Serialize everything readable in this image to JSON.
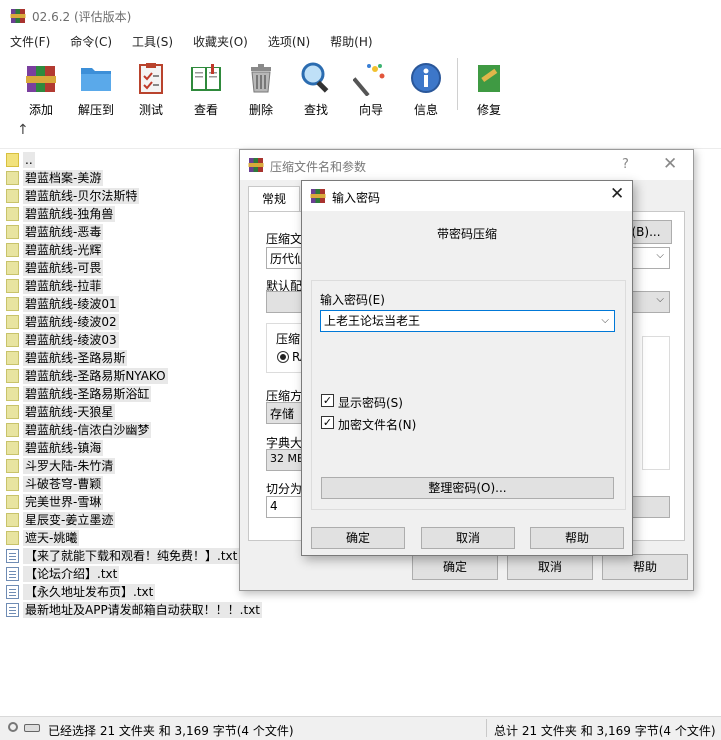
{
  "window": {
    "title": "02.6.2 (评估版本)",
    "menu": [
      "文件(F)",
      "命令(C)",
      "工具(S)",
      "收藏夹(O)",
      "选项(N)",
      "帮助(H)"
    ],
    "toolbar": [
      {
        "label": "添加",
        "icon": "add-archive-icon"
      },
      {
        "label": "解压到",
        "icon": "extract-folder-icon"
      },
      {
        "label": "测试",
        "icon": "test-clipboard-icon"
      },
      {
        "label": "查看",
        "icon": "view-book-icon"
      },
      {
        "label": "删除",
        "icon": "delete-trash-icon"
      },
      {
        "label": "查找",
        "icon": "find-magnifier-icon"
      },
      {
        "label": "向导",
        "icon": "wizard-wand-icon"
      },
      {
        "label": "信息",
        "icon": "info-icon"
      },
      {
        "label": "修复",
        "icon": "repair-icon"
      }
    ]
  },
  "files": [
    {
      "name": "..",
      "type": "parent"
    },
    {
      "name": "碧蓝档案-美游",
      "type": "folder"
    },
    {
      "name": "碧蓝航线-贝尔法斯特",
      "type": "folder"
    },
    {
      "name": "碧蓝航线-独角兽",
      "type": "folder"
    },
    {
      "name": "碧蓝航线-恶毒",
      "type": "folder"
    },
    {
      "name": "碧蓝航线-光辉",
      "type": "folder"
    },
    {
      "name": "碧蓝航线-可畏",
      "type": "folder"
    },
    {
      "name": "碧蓝航线-拉菲",
      "type": "folder"
    },
    {
      "name": "碧蓝航线-绫波01",
      "type": "folder"
    },
    {
      "name": "碧蓝航线-绫波02",
      "type": "folder"
    },
    {
      "name": "碧蓝航线-绫波03",
      "type": "folder"
    },
    {
      "name": "碧蓝航线-圣路易斯",
      "type": "folder"
    },
    {
      "name": "碧蓝航线-圣路易斯NYAKO",
      "type": "folder"
    },
    {
      "name": "碧蓝航线-圣路易斯浴缸",
      "type": "folder"
    },
    {
      "name": "碧蓝航线-天狼星",
      "type": "folder"
    },
    {
      "name": "碧蓝航线-信浓白沙幽梦",
      "type": "folder"
    },
    {
      "name": "碧蓝航线-镇海",
      "type": "folder"
    },
    {
      "name": "斗罗大陆-朱竹清",
      "type": "folder"
    },
    {
      "name": "斗破苍穹-曹颖",
      "type": "folder"
    },
    {
      "name": "完美世界-雪琳",
      "type": "folder"
    },
    {
      "name": "星辰变-姜立墨迹",
      "type": "folder"
    },
    {
      "name": "遮天-姚曦",
      "type": "folder"
    },
    {
      "name": "【来了就能下载和观看！纯免费！】.txt",
      "type": "file"
    },
    {
      "name": "【论坛介绍】.txt",
      "type": "file"
    },
    {
      "name": "【永久地址发布页】.txt",
      "type": "file"
    },
    {
      "name": "最新地址及APP请发邮箱自动获取！！！.txt",
      "type": "file"
    }
  ],
  "status": {
    "left": "已经选择 21 文件夹 和 3,169 字节(4 个文件)",
    "right": "总计 21 文件夹 和 3,169 字节(4 个文件)"
  },
  "archive_dialog": {
    "title": "压缩文件名和参数",
    "help": "?",
    "close": "✕",
    "tab_general": "常规",
    "label_archive_name": "压缩文",
    "archive_name_value": "历代仙",
    "browse_label": "(B)...",
    "label_default_profile": "默认配",
    "label_format": "压缩",
    "format_rar": "RA",
    "label_method": "压缩方",
    "method_value": "存储",
    "label_dict": "字典大",
    "dict_value": "32 MB",
    "label_split": "切分为",
    "split_value": "4",
    "ok": "确定",
    "cancel": "取消",
    "help_button": "帮助"
  },
  "password_dialog": {
    "title": "输入密码",
    "close": "✕",
    "heading": "带密码压缩",
    "password_label": "输入密码(E)",
    "password_value": "上老王论坛当老王",
    "show_password": "显示密码(S)",
    "encrypt_names": "加密文件名(N)",
    "organize": "整理密码(O)...",
    "ok": "确定",
    "cancel": "取消",
    "help": "帮助"
  }
}
